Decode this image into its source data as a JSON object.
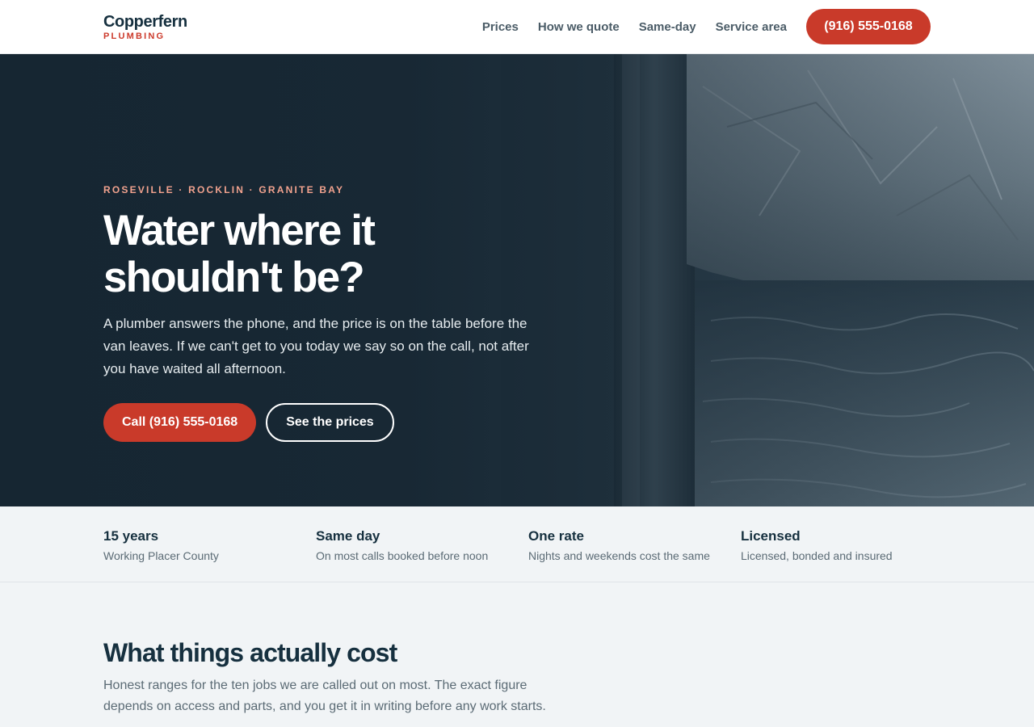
{
  "brand": {
    "name": "Copperfern",
    "sub": "PLUMBING"
  },
  "nav": {
    "items": [
      {
        "label": "Prices"
      },
      {
        "label": "How we quote"
      },
      {
        "label": "Same-day"
      },
      {
        "label": "Service area"
      }
    ],
    "phone_cta": "(916) 555-0168"
  },
  "hero": {
    "kicker": "ROSEVILLE · ROCKLIN · GRANITE BAY",
    "title": "Water where it shouldn't be?",
    "lead": "A plumber answers the phone, and the price is on the table before the van leaves. If we can't get to you today we say so on the call, not after you have waited all afternoon.",
    "primary_cta": "Call (916) 555-0168",
    "secondary_cta": "See the prices"
  },
  "stats": [
    {
      "title": "15 years",
      "sub": "Working Placer County"
    },
    {
      "title": "Same day",
      "sub": "On most calls booked before noon"
    },
    {
      "title": "One rate",
      "sub": "Nights and weekends cost the same"
    },
    {
      "title": "Licensed",
      "sub": "Licensed, bonded and insured"
    }
  ],
  "prices": {
    "title": "What things actually cost",
    "lead": "Honest ranges for the ten jobs we are called out on most. The exact figure depends on access and parts, and you get it in writing before any work starts."
  },
  "colors": {
    "accent": "#c93a2a",
    "navy": "#16303f",
    "kicker": "#f1a28e"
  }
}
